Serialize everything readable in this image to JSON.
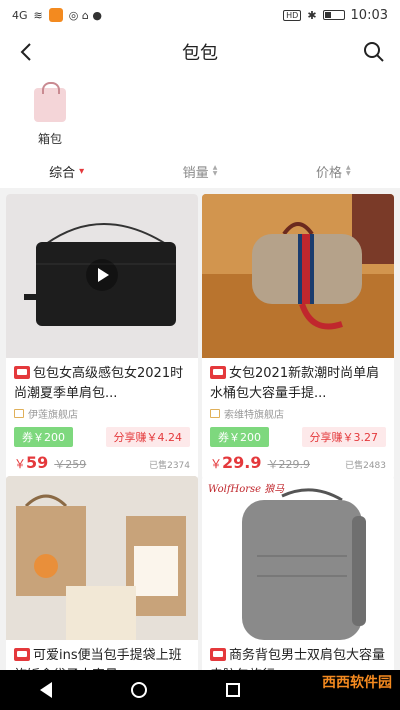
{
  "status_bar": {
    "signal": "4G",
    "time": "10:03",
    "hd": "HD",
    "icons": [
      "signal-icon",
      "wifi-icon",
      "app-icon",
      "notification-icon",
      "bluetooth-icon",
      "battery-icon"
    ]
  },
  "header": {
    "title": "包包",
    "back_icon": "back-arrow-icon",
    "search_icon": "search-icon"
  },
  "categories": [
    {
      "label": "箱包",
      "icon": "handbag-thumbnail"
    }
  ],
  "sort_bar": {
    "items": [
      {
        "label": "综合",
        "active": true
      },
      {
        "label": "销量",
        "active": false
      },
      {
        "label": "价格",
        "active": false
      }
    ]
  },
  "products": [
    {
      "title": "包包女高级感包女2021时尚潮夏季单肩包...",
      "shop": "伊莲旗舰店",
      "coupon": "券￥200",
      "share": "分享赚￥4.24",
      "price_symbol": "￥",
      "price": "59",
      "orig_price": "￥259",
      "sold": "已售2374",
      "has_video": true,
      "image_colors": {
        "bg": "#e7e4e4",
        "bag": "#1d1d1d"
      }
    },
    {
      "title": "女包2021新款潮时尚单肩水桶包大容量手提...",
      "shop": "索维特旗舰店",
      "coupon": "券￥200",
      "share": "分享赚￥3.27",
      "price_symbol": "￥",
      "price": "29.9",
      "orig_price": "￥229.9",
      "sold": "已售2483",
      "has_video": false,
      "image_colors": {
        "bg": "#c98a4a",
        "bag": "#b5a28a"
      }
    },
    {
      "title": "可爱ins便当包手提袋上班族饭盒袋子大容量...",
      "shop": "",
      "coupon": "",
      "share": "",
      "price_symbol": "",
      "price": "",
      "orig_price": "",
      "sold": "",
      "has_video": false,
      "image_colors": {
        "bg": "#d7cfc4",
        "bag": "#c8a37a"
      }
    },
    {
      "title": "商务背包男士双肩包大容量电脑包旅行...",
      "shop": "",
      "coupon": "",
      "share": "",
      "price_symbol": "",
      "price": "",
      "orig_price": "",
      "sold": "",
      "has_video": false,
      "brand_text": "WolfHorse 狼马",
      "image_colors": {
        "bg": "#ffffff",
        "bag": "#8a8a8a"
      }
    }
  ],
  "nav_bar": {
    "icons": [
      "nav-back-icon",
      "nav-home-icon",
      "nav-recent-icon"
    ]
  },
  "watermark": "西西软件园"
}
